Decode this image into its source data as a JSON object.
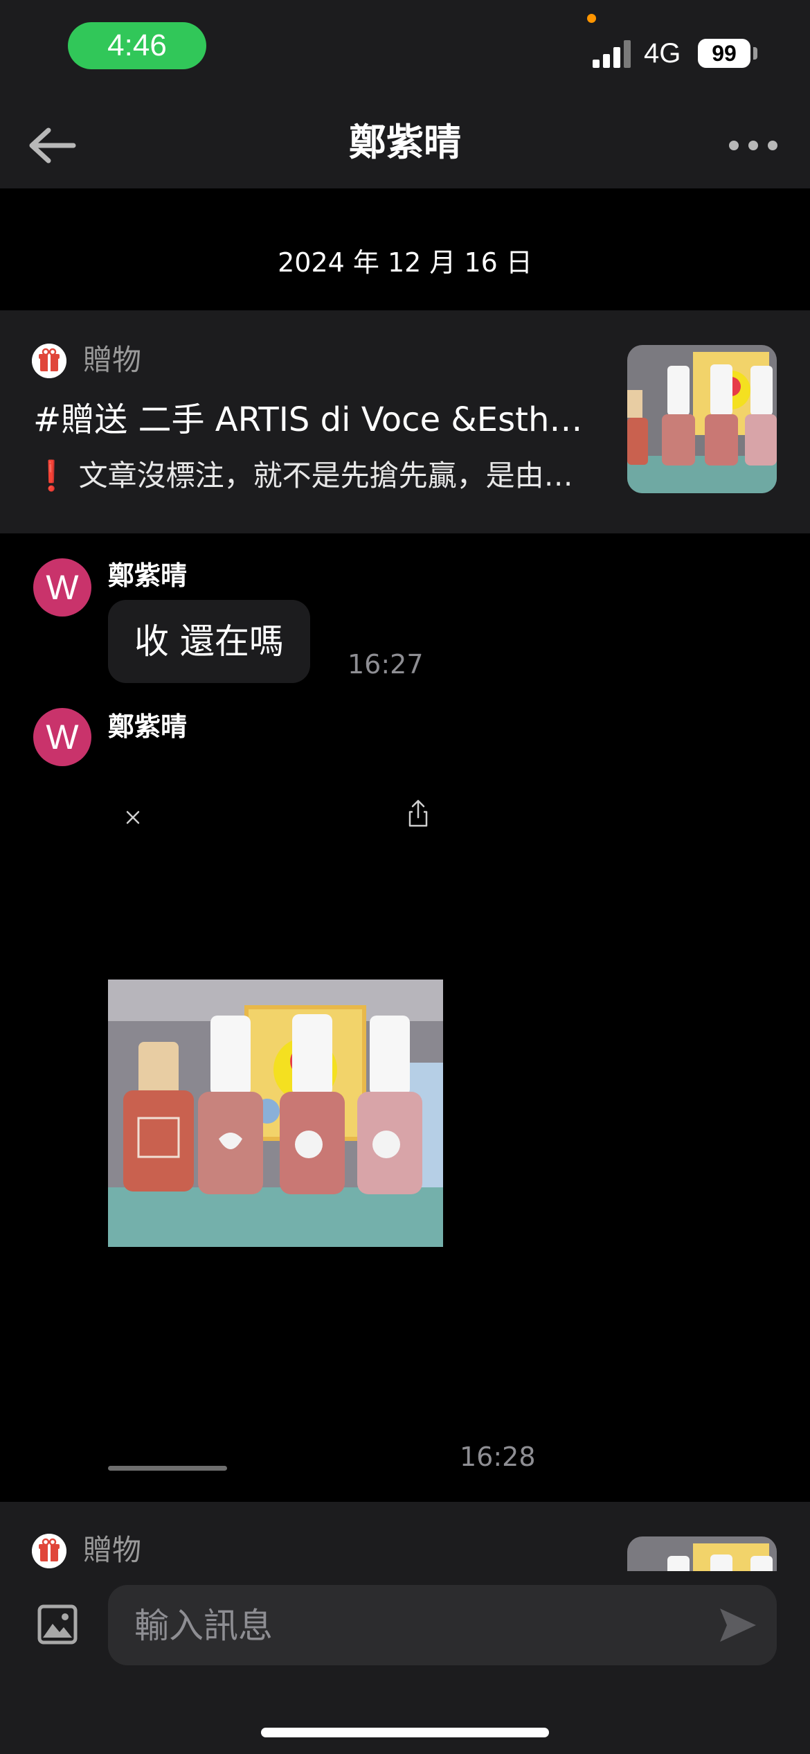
{
  "status_bar": {
    "time": "4:46",
    "network": "4G",
    "battery": "99"
  },
  "header": {
    "title": "鄭紫晴"
  },
  "date_separator": "2024 年 12 月 16 日",
  "listing": {
    "category": "贈物",
    "title": "#贈送 二手 ARTIS di Voce &Esth…",
    "description": "❗ 文章沒標注，就不是先搶先贏，是由…"
  },
  "messages": [
    {
      "avatar_letter": "W",
      "sender": "鄭紫晴",
      "text": "收 還在嗎",
      "time": "16:27"
    },
    {
      "avatar_letter": "W",
      "sender": "鄭紫晴",
      "time": "16:28"
    }
  ],
  "listing_peek": {
    "category": "贈物"
  },
  "composer": {
    "placeholder": "輸入訊息"
  },
  "icons": {
    "back": "back-arrow-icon",
    "more": "more-icon",
    "gift": "gift-icon",
    "close": "close-icon",
    "share": "share-icon",
    "photo": "image-icon",
    "send": "send-icon"
  },
  "colors": {
    "accent_time_pill": "#31c759",
    "avatar": "#c9336b",
    "surface": "#1c1c1e",
    "background": "#000000"
  }
}
